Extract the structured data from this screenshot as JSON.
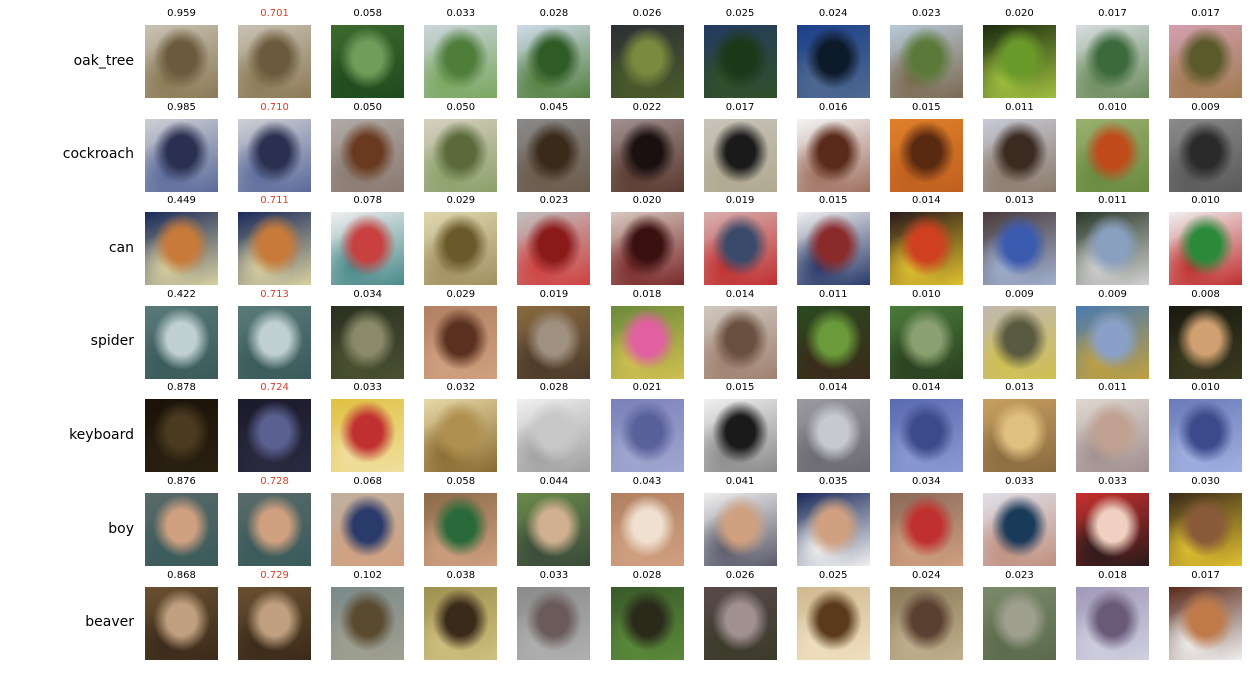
{
  "rows": [
    {
      "label": "oak_tree",
      "scores": [
        "0.959",
        "0.701",
        "0.058",
        "0.033",
        "0.028",
        "0.026",
        "0.025",
        "0.024",
        "0.023",
        "0.020",
        "0.017",
        "0.017"
      ],
      "highlight_index": 1,
      "palettes": [
        [
          "#c9c2b4",
          "#6b5a3c",
          "#8a7a55"
        ],
        [
          "#c9c2b4",
          "#6b5a3c",
          "#8a7a55"
        ],
        [
          "#3d6a2e",
          "#6f9e5b",
          "#1f4a1d"
        ],
        [
          "#cbd6de",
          "#4f7d3a",
          "#7aa65e"
        ],
        [
          "#cfdceb",
          "#2f5b26",
          "#547f3f"
        ],
        [
          "#2b2f36",
          "#7a8a3e",
          "#4b5b2a"
        ],
        [
          "#243a62",
          "#1b3818",
          "#2f5027"
        ],
        [
          "#1b3f8a",
          "#0d1a2a",
          "#506a90"
        ],
        [
          "#b7c9d8",
          "#5b7a3a",
          "#7b6a50"
        ],
        [
          "#1a2b10",
          "#6a9a2a",
          "#a0c040"
        ],
        [
          "#d7dde0",
          "#3c6a3c",
          "#6c8c5c"
        ],
        [
          "#d4a0b0",
          "#5a5a2a",
          "#a07a50"
        ]
      ]
    },
    {
      "label": "cockroach",
      "scores": [
        "0.985",
        "0.710",
        "0.050",
        "0.050",
        "0.045",
        "0.022",
        "0.017",
        "0.016",
        "0.015",
        "0.011",
        "0.010",
        "0.009"
      ],
      "highlight_index": 1,
      "palettes": [
        [
          "#cfd0d6",
          "#2a3050",
          "#5a6a9a"
        ],
        [
          "#cfd0d6",
          "#2a3050",
          "#5a6a9a"
        ],
        [
          "#b0aaa6",
          "#6a3a20",
          "#8a7a70"
        ],
        [
          "#d8d0c0",
          "#5a6a3a",
          "#8aa06a"
        ],
        [
          "#8a8a8a",
          "#3a2a1a",
          "#6a5a4a"
        ],
        [
          "#a09090",
          "#1a1010",
          "#5a3a30"
        ],
        [
          "#c8c4ba",
          "#1a1a1a",
          "#b0a890"
        ],
        [
          "#f4f4f4",
          "#5a2a1a",
          "#a07060"
        ],
        [
          "#e0802a",
          "#5a2a10",
          "#c06020"
        ],
        [
          "#c8cad8",
          "#3a2a20",
          "#8a7a6a"
        ],
        [
          "#9ab070",
          "#c04a1a",
          "#6a8a40"
        ],
        [
          "#8a8a8a",
          "#2a2a2a",
          "#5a5a5a"
        ]
      ]
    },
    {
      "label": "can",
      "scores": [
        "0.449",
        "0.711",
        "0.078",
        "0.029",
        "0.023",
        "0.020",
        "0.019",
        "0.015",
        "0.014",
        "0.013",
        "0.011",
        "0.010"
      ],
      "highlight_index": 1,
      "palettes": [
        [
          "#1a2a5a",
          "#c87a3a",
          "#d8d0a0"
        ],
        [
          "#1a2a5a",
          "#c87a3a",
          "#d8d0a0"
        ],
        [
          "#f0f0f0",
          "#c84040",
          "#4a8a8a"
        ],
        [
          "#e0d8b0",
          "#6a5a2a",
          "#a09060"
        ],
        [
          "#c0c0c0",
          "#8a1a1a",
          "#d04040"
        ],
        [
          "#d8c8c0",
          "#3a1010",
          "#7a2a2a"
        ],
        [
          "#d8b0b0",
          "#3a4a6a",
          "#c03030"
        ],
        [
          "#f0f0f0",
          "#8a2a2a",
          "#2a3a6a"
        ],
        [
          "#2a1a1a",
          "#d04020",
          "#e0c030"
        ],
        [
          "#4a3a3a",
          "#3a5ab0",
          "#a0b0d0"
        ],
        [
          "#2a3a2a",
          "#8aa0c0",
          "#d0d0d0"
        ],
        [
          "#f0f0f0",
          "#2a8a3a",
          "#c03030"
        ]
      ]
    },
    {
      "label": "spider",
      "scores": [
        "0.422",
        "0.713",
        "0.034",
        "0.029",
        "0.019",
        "0.018",
        "0.014",
        "0.011",
        "0.010",
        "0.009",
        "0.009",
        "0.008"
      ],
      "highlight_index": 1,
      "palettes": [
        [
          "#5a7a7a",
          "#c0d0d0",
          "#3a5a5a"
        ],
        [
          "#5a7a7a",
          "#c0d0d0",
          "#3a5a5a"
        ],
        [
          "#2a3020",
          "#8a8a6a",
          "#4a5030"
        ],
        [
          "#b08060",
          "#5a3020",
          "#d0a080"
        ],
        [
          "#8a6a40",
          "#a09080",
          "#4a3a2a"
        ],
        [
          "#6a8a3a",
          "#e060a0",
          "#d0c050"
        ],
        [
          "#d0c8c0",
          "#6a5040",
          "#a08070"
        ],
        [
          "#2a4a20",
          "#6a9a3a",
          "#3a2a1a"
        ],
        [
          "#4a7a3a",
          "#8aa070",
          "#2a4020"
        ],
        [
          "#c0b8b0",
          "#5a5a40",
          "#d0c050"
        ],
        [
          "#4a7ab0",
          "#8aa0c8",
          "#c0a040"
        ],
        [
          "#1a1a10",
          "#d0a070",
          "#3a3a20"
        ]
      ]
    },
    {
      "label": "keyboard",
      "scores": [
        "0.878",
        "0.724",
        "0.033",
        "0.032",
        "0.028",
        "0.021",
        "0.015",
        "0.014",
        "0.014",
        "0.013",
        "0.011",
        "0.010"
      ],
      "highlight_index": 1,
      "palettes": [
        [
          "#1a1208",
          "#4a3a20",
          "#2a2010"
        ],
        [
          "#1a1a2a",
          "#5a6090",
          "#2a2a40"
        ],
        [
          "#e0c040",
          "#c03030",
          "#f0e0a0"
        ],
        [
          "#e8d8a8",
          "#b09050",
          "#8a6a30"
        ],
        [
          "#f0f0f0",
          "#c8c8c8",
          "#a0a0a0"
        ],
        [
          "#7a80b8",
          "#5a609a",
          "#a0a8d0"
        ],
        [
          "#f0f0f0",
          "#1a1a1a",
          "#8a8a8a"
        ],
        [
          "#9a9aa0",
          "#c8c8d0",
          "#6a6a70"
        ],
        [
          "#5a6ab0",
          "#3a4a8a",
          "#8a9ad0"
        ],
        [
          "#c8a060",
          "#e0c080",
          "#8a6a40"
        ],
        [
          "#e0d8d0",
          "#c0a090",
          "#a09090"
        ],
        [
          "#6a7ab8",
          "#3a4a8a",
          "#a0b0e0"
        ]
      ]
    },
    {
      "label": "boy",
      "scores": [
        "0.876",
        "0.728",
        "0.068",
        "0.058",
        "0.044",
        "0.043",
        "0.041",
        "0.035",
        "0.034",
        "0.033",
        "0.033",
        "0.030"
      ],
      "highlight_index": 1,
      "palettes": [
        [
          "#5a6a6a",
          "#d0a080",
          "#3a5a5a"
        ],
        [
          "#5a6a6a",
          "#d0a080",
          "#3a5a5a"
        ],
        [
          "#c0b0a0",
          "#2a3a6a",
          "#d0a080"
        ],
        [
          "#8a6a4a",
          "#2a6a3a",
          "#d0a080"
        ],
        [
          "#6a8a4a",
          "#d0b090",
          "#3a4a3a"
        ],
        [
          "#b08060",
          "#f0e0d0",
          "#d0a080"
        ],
        [
          "#f0f0f0",
          "#d0a080",
          "#5a5a6a"
        ],
        [
          "#1a2a5a",
          "#d0a080",
          "#f0f0f0"
        ],
        [
          "#8a6a5a",
          "#c03030",
          "#d0a080"
        ],
        [
          "#e0e0e8",
          "#1a3a5a",
          "#c09080"
        ],
        [
          "#c83030",
          "#f0d0c0",
          "#2a1a1a"
        ],
        [
          "#3a2a1a",
          "#8a5a3a",
          "#e0c030"
        ]
      ]
    },
    {
      "label": "beaver",
      "scores": [
        "0.868",
        "0.729",
        "0.102",
        "0.038",
        "0.033",
        "0.028",
        "0.026",
        "0.025",
        "0.024",
        "0.023",
        "0.018",
        "0.017"
      ],
      "highlight_index": 1,
      "palettes": [
        [
          "#6a5030",
          "#c0a080",
          "#3a2a1a"
        ],
        [
          "#6a5030",
          "#c0a080",
          "#3a2a1a"
        ],
        [
          "#7a8a8a",
          "#5a4a30",
          "#a0a090"
        ],
        [
          "#a09050",
          "#3a2a1a",
          "#d0c080"
        ],
        [
          "#8a8a8a",
          "#6a5a5a",
          "#b0b0b0"
        ],
        [
          "#3a5a2a",
          "#2a2a1a",
          "#5a8a3a"
        ],
        [
          "#5a4a4a",
          "#a09090",
          "#3a3a2a"
        ],
        [
          "#d0b890",
          "#5a3a1a",
          "#f0e0c0"
        ],
        [
          "#8a7a5a",
          "#5a4030",
          "#c0b090"
        ],
        [
          "#7a8a6a",
          "#a0a090",
          "#5a6a4a"
        ],
        [
          "#a098b8",
          "#6a5a7a",
          "#d0d0e0"
        ],
        [
          "#5a2a1a",
          "#c07a4a",
          "#f0f0f0"
        ]
      ]
    }
  ]
}
